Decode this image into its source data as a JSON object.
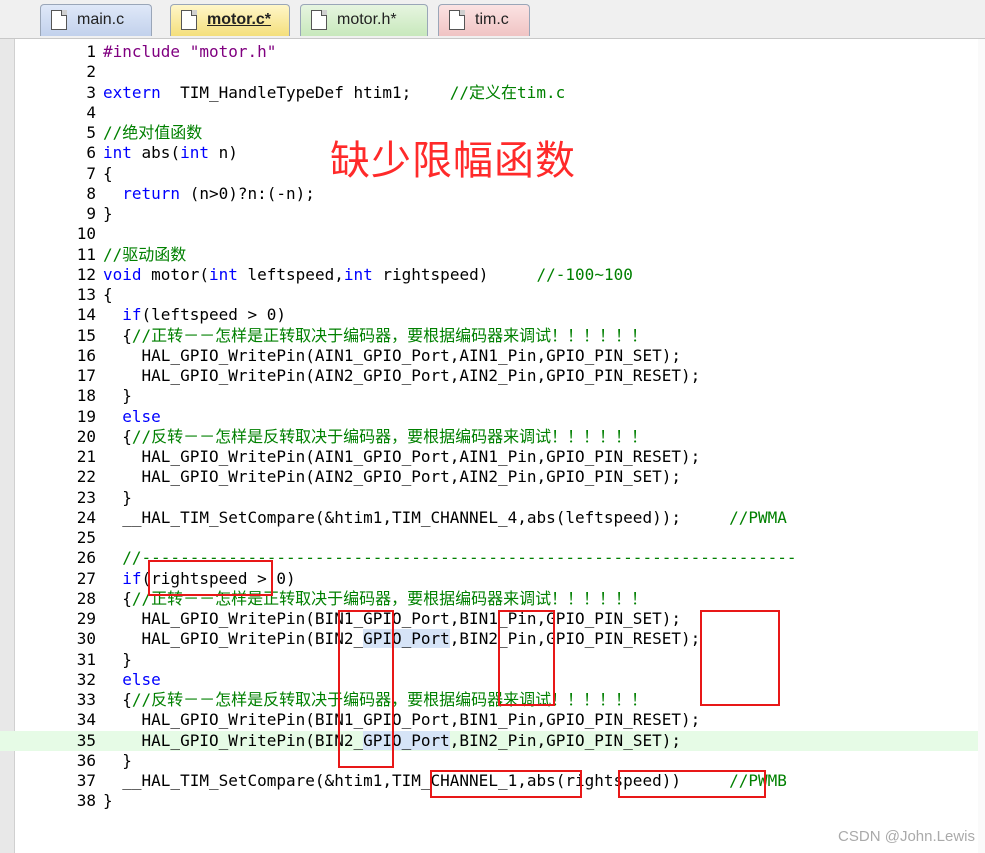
{
  "tabs": [
    {
      "label": "main.c"
    },
    {
      "label": "motor.c*"
    },
    {
      "label": "motor.h*"
    },
    {
      "label": "tim.c"
    }
  ],
  "annotation": "缺少限幅函数",
  "watermark": "CSDN @John.Lewis",
  "lines": [
    {
      "n": "1",
      "parts": [
        [
          "pp",
          "#include "
        ],
        [
          "st",
          "\"motor.h\""
        ]
      ]
    },
    {
      "n": "2",
      "parts": []
    },
    {
      "n": "3",
      "parts": [
        [
          "kw",
          "extern"
        ],
        [
          "",
          "  TIM_HandleTypeDef htim1;    "
        ],
        [
          "cm",
          "//定义在tim.c"
        ]
      ]
    },
    {
      "n": "4",
      "parts": []
    },
    {
      "n": "5",
      "parts": [
        [
          "cm",
          "//绝对值函数"
        ]
      ]
    },
    {
      "n": "6",
      "parts": [
        [
          "kw",
          "int"
        ],
        [
          "",
          " abs("
        ],
        [
          "kw",
          "int"
        ],
        [
          "",
          " n)"
        ]
      ]
    },
    {
      "n": "7",
      "parts": [
        [
          "",
          "{"
        ]
      ]
    },
    {
      "n": "8",
      "parts": [
        [
          "",
          "  "
        ],
        [
          "kw",
          "return"
        ],
        [
          "",
          " (n>0)?n:(-n);"
        ]
      ]
    },
    {
      "n": "9",
      "parts": [
        [
          "",
          "}"
        ]
      ]
    },
    {
      "n": "10",
      "parts": []
    },
    {
      "n": "11",
      "parts": [
        [
          "cm",
          "//驱动函数"
        ]
      ]
    },
    {
      "n": "12",
      "parts": [
        [
          "kw",
          "void"
        ],
        [
          "",
          " motor("
        ],
        [
          "kw",
          "int"
        ],
        [
          "",
          " leftspeed,"
        ],
        [
          "kw",
          "int"
        ],
        [
          "",
          " rightspeed)     "
        ],
        [
          "cm",
          "//-100~100"
        ]
      ]
    },
    {
      "n": "13",
      "parts": [
        [
          "",
          "{"
        ]
      ]
    },
    {
      "n": "14",
      "parts": [
        [
          "",
          "  "
        ],
        [
          "kw",
          "if"
        ],
        [
          "",
          "(leftspeed > 0)"
        ]
      ]
    },
    {
      "n": "15",
      "parts": [
        [
          "",
          "  {"
        ],
        [
          "cm",
          "//正转－－怎样是正转取决于编码器，要根据编码器来调试！！！！！！"
        ]
      ]
    },
    {
      "n": "16",
      "parts": [
        [
          "",
          "    HAL_GPIO_WritePin(AIN1_GPIO_Port,AIN1_Pin,GPIO_PIN_SET);"
        ]
      ]
    },
    {
      "n": "17",
      "parts": [
        [
          "",
          "    HAL_GPIO_WritePin(AIN2_GPIO_Port,AIN2_Pin,GPIO_PIN_RESET);"
        ]
      ]
    },
    {
      "n": "18",
      "parts": [
        [
          "",
          "  }"
        ]
      ]
    },
    {
      "n": "19",
      "parts": [
        [
          "",
          "  "
        ],
        [
          "kw",
          "else"
        ]
      ]
    },
    {
      "n": "20",
      "parts": [
        [
          "",
          "  {"
        ],
        [
          "cm",
          "//反转－－怎样是反转取决于编码器，要根据编码器来调试！！！！！！"
        ]
      ]
    },
    {
      "n": "21",
      "parts": [
        [
          "",
          "    HAL_GPIO_WritePin(AIN1_GPIO_Port,AIN1_Pin,GPIO_PIN_RESET);"
        ]
      ]
    },
    {
      "n": "22",
      "parts": [
        [
          "",
          "    HAL_GPIO_WritePin(AIN2_GPIO_Port,AIN2_Pin,GPIO_PIN_SET);"
        ]
      ]
    },
    {
      "n": "23",
      "parts": [
        [
          "",
          "  }"
        ]
      ]
    },
    {
      "n": "24",
      "parts": [
        [
          "",
          "  __HAL_TIM_SetCompare(&htim1,TIM_CHANNEL_4,abs(leftspeed));     "
        ],
        [
          "cm",
          "//PWMA"
        ]
      ]
    },
    {
      "n": "25",
      "parts": []
    },
    {
      "n": "26",
      "parts": [
        [
          "",
          "  "
        ],
        [
          "cm",
          "//--------------------------------------------------------------------"
        ]
      ]
    },
    {
      "n": "27",
      "parts": [
        [
          "",
          "  "
        ],
        [
          "kw",
          "if"
        ],
        [
          "",
          "(rightspeed > 0)"
        ]
      ]
    },
    {
      "n": "28",
      "parts": [
        [
          "",
          "  {"
        ],
        [
          "cm",
          "//正转－－怎样是正转取决于编码器，要根据编码器来调试！！！！！！"
        ]
      ]
    },
    {
      "n": "29",
      "parts": [
        [
          "",
          "    HAL_GPIO_WritePin(BIN1_GPIO_Port,BIN1_Pin,GPIO_PIN_SET);"
        ]
      ]
    },
    {
      "n": "30",
      "parts": [
        [
          "",
          "    HAL_GPIO_WritePin(BIN2_"
        ],
        [
          "sel",
          "GPIO_Port"
        ],
        [
          "",
          ",BIN2_Pin,GPIO_PIN_RESET);"
        ]
      ]
    },
    {
      "n": "31",
      "parts": [
        [
          "",
          "  }"
        ]
      ]
    },
    {
      "n": "32",
      "parts": [
        [
          "",
          "  "
        ],
        [
          "kw",
          "else"
        ]
      ]
    },
    {
      "n": "33",
      "parts": [
        [
          "",
          "  {"
        ],
        [
          "cm",
          "//反转－－怎样是反转取决于编码器，要根据编码器来调试！！！！！！"
        ]
      ]
    },
    {
      "n": "34",
      "parts": [
        [
          "",
          "    HAL_GPIO_WritePin(BIN1_GPIO_Port,BIN1_Pin,GPIO_PIN_RESET);"
        ]
      ]
    },
    {
      "n": "35",
      "hl": true,
      "parts": [
        [
          "",
          "    HAL_GPIO_WritePin(BIN2_"
        ],
        [
          "sel",
          "GPIO_Port"
        ],
        [
          "",
          ",BIN2_Pin,GPIO_PIN_SET);"
        ]
      ]
    },
    {
      "n": "36",
      "parts": [
        [
          "",
          "  }"
        ]
      ]
    },
    {
      "n": "37",
      "parts": [
        [
          "",
          "  __HAL_TIM_SetCompare(&htim1,TIM_CHANNEL_1,abs(rightspeed))     "
        ],
        [
          "cm",
          "//PWMB"
        ]
      ]
    },
    {
      "n": "38",
      "parts": [
        [
          "",
          "}"
        ]
      ]
    }
  ]
}
